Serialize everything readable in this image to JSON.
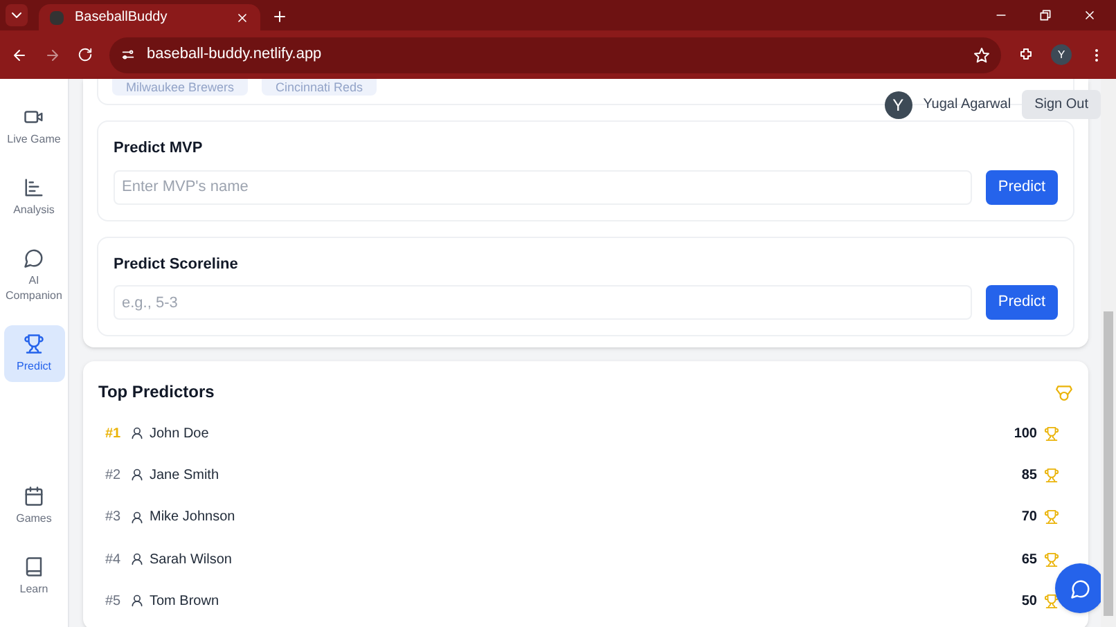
{
  "browser": {
    "tab_title": "BaseballBuddy",
    "url": "baseball-buddy.netlify.app",
    "profile_initial": "Y"
  },
  "sidebar": {
    "items": [
      {
        "label": "Live Game",
        "kind": "video",
        "selected": false
      },
      {
        "label": "Analysis",
        "kind": "chart",
        "selected": false
      },
      {
        "label": "AI Companion",
        "kind": "chat",
        "selected": false
      },
      {
        "label": "Predict",
        "kind": "trophy",
        "selected": true
      }
    ],
    "bottom_items": [
      {
        "label": "Games",
        "kind": "calendar",
        "selected": false
      },
      {
        "label": "Learn",
        "kind": "book",
        "selected": false
      }
    ]
  },
  "user": {
    "initial": "Y",
    "name": "Yugal Agarwal",
    "sign_out": "Sign Out"
  },
  "teams": [
    "Milwaukee Brewers",
    "Cincinnati Reds"
  ],
  "predictions": [
    {
      "title": "Predict MVP",
      "placeholder": "Enter MVP's name",
      "button": "Predict"
    },
    {
      "title": "Predict Scoreline",
      "placeholder": "e.g., 5-3",
      "button": "Predict"
    }
  ],
  "leaderboard": {
    "title": "Top Predictors",
    "rows": [
      {
        "rank": "#1",
        "name": "John Doe",
        "points": "100",
        "highlighted": true
      },
      {
        "rank": "#2",
        "name": "Jane Smith",
        "points": "85",
        "highlighted": false
      },
      {
        "rank": "#3",
        "name": "Mike Johnson",
        "points": "70",
        "highlighted": false
      },
      {
        "rank": "#4",
        "name": "Sarah Wilson",
        "points": "65",
        "highlighted": false
      },
      {
        "rank": "#5",
        "name": "Tom Brown",
        "points": "50",
        "highlighted": false
      }
    ]
  }
}
